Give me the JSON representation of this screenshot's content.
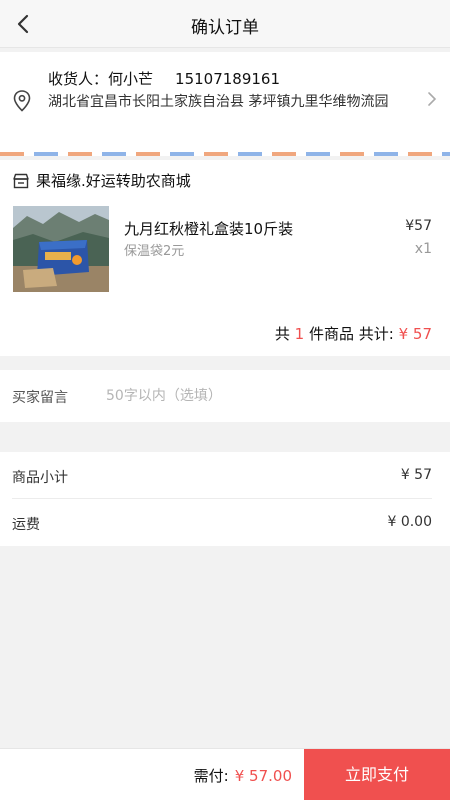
{
  "header": {
    "title": "确认订单"
  },
  "address": {
    "receiver_label": "收货人：",
    "receiver_name": "何小芒",
    "phone": "15107189161",
    "detail": "湖北省宜昌市长阳土家族自治县 茅坪镇九里华维物流园"
  },
  "shop": {
    "name": "果福缘.好运转助农商城",
    "product": {
      "name": "九月红秋橙礼盒装10斤装",
      "spec": "保温袋2元",
      "price": "¥57",
      "qty": "x1"
    },
    "total": {
      "prefix": "共",
      "count": "1",
      "mid": "件商品 共计:",
      "amount": "¥ 57"
    }
  },
  "remark": {
    "label": "买家留言",
    "placeholder": "50字以内（选填）"
  },
  "summary": {
    "subtotal_label": "商品小计",
    "subtotal_value": "¥ 57",
    "shipping_label": "运费",
    "shipping_value": "¥ 0.00"
  },
  "footer": {
    "need_label": "需付:",
    "need_amount": "¥ 57.00",
    "pay_label": "立即支付"
  },
  "colors": {
    "accent": "#f0504f"
  }
}
